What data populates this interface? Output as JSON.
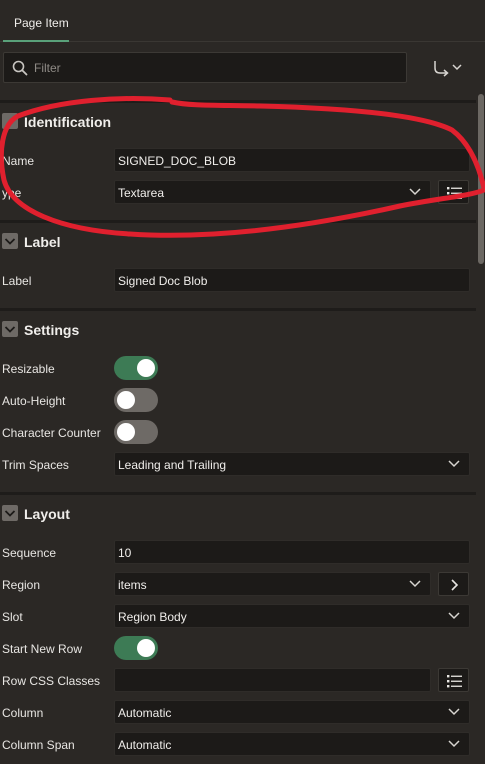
{
  "tabs": [
    {
      "label": "Page Item"
    }
  ],
  "filter": {
    "placeholder": "Filter"
  },
  "sections": {
    "identification": {
      "title": "Identification",
      "name_label": "Name",
      "name_value": "SIGNED_DOC_BLOB",
      "type_label": "ype",
      "type_value": "Textarea"
    },
    "label": {
      "title": "Label",
      "label_label": "Label",
      "label_value": "Signed Doc Blob"
    },
    "settings": {
      "title": "Settings",
      "resizable_label": "Resizable",
      "resizable_on": true,
      "auto_height_label": "Auto-Height",
      "auto_height_on": false,
      "char_counter_label": "Character Counter",
      "char_counter_on": false,
      "trim_label": "Trim Spaces",
      "trim_value": "Leading and Trailing"
    },
    "layout": {
      "title": "Layout",
      "sequence_label": "Sequence",
      "sequence_value": "10",
      "region_label": "Region",
      "region_value": "items",
      "slot_label": "Slot",
      "slot_value": "Region Body",
      "start_new_row_label": "Start New Row",
      "start_new_row_on": true,
      "row_css_label": "Row CSS Classes",
      "row_css_value": "",
      "column_label": "Column",
      "column_value": "Automatic",
      "column_span_label": "Column Span",
      "column_span_value": "Automatic"
    }
  },
  "colors": {
    "background": "#2b2825",
    "field": "#1c1a18",
    "toggle_on": "#3d7b55",
    "toggle_off": "#6e6a66",
    "tab_accent": "#5aa17a",
    "annotation": "#e0202e"
  }
}
